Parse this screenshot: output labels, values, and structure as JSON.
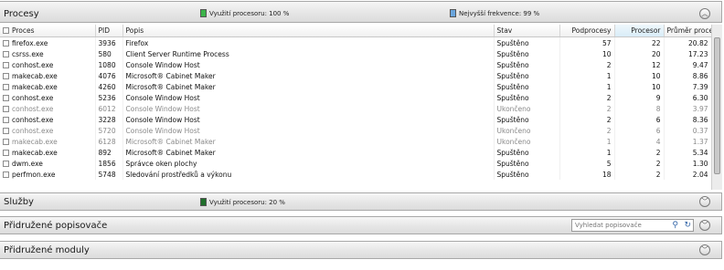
{
  "processes": {
    "title": "Procesy",
    "cpu_usage": "Využití procesoru: 100 %",
    "max_freq": "Nejvyšší frekvence: 99 %",
    "cpu_color": "#3cb44a",
    "freq_color": "#6aa5dd",
    "columns": [
      "Proces",
      "PID",
      "Popis",
      "Stav",
      "Podprocesy",
      "Procesor",
      "Průměr proces..."
    ],
    "rows": [
      {
        "name": "firefox.exe",
        "pid": "3936",
        "desc": "Firefox",
        "state": "Spuštěno",
        "threads": "57",
        "cpu": "22",
        "avg": "20.82",
        "dim": false
      },
      {
        "name": "csrss.exe",
        "pid": "580",
        "desc": "Client Server Runtime Process",
        "state": "Spuštěno",
        "threads": "10",
        "cpu": "20",
        "avg": "17.23",
        "dim": false
      },
      {
        "name": "conhost.exe",
        "pid": "1080",
        "desc": "Console Window Host",
        "state": "Spuštěno",
        "threads": "2",
        "cpu": "12",
        "avg": "9.47",
        "dim": false
      },
      {
        "name": "makecab.exe",
        "pid": "4076",
        "desc": "Microsoft® Cabinet Maker",
        "state": "Spuštěno",
        "threads": "1",
        "cpu": "10",
        "avg": "8.86",
        "dim": false
      },
      {
        "name": "makecab.exe",
        "pid": "4260",
        "desc": "Microsoft® Cabinet Maker",
        "state": "Spuštěno",
        "threads": "1",
        "cpu": "10",
        "avg": "7.39",
        "dim": false
      },
      {
        "name": "conhost.exe",
        "pid": "5236",
        "desc": "Console Window Host",
        "state": "Spuštěno",
        "threads": "2",
        "cpu": "9",
        "avg": "6.30",
        "dim": false
      },
      {
        "name": "conhost.exe",
        "pid": "6012",
        "desc": "Console Window Host",
        "state": "Ukončeno",
        "threads": "2",
        "cpu": "8",
        "avg": "3.97",
        "dim": true
      },
      {
        "name": "conhost.exe",
        "pid": "3228",
        "desc": "Console Window Host",
        "state": "Spuštěno",
        "threads": "2",
        "cpu": "6",
        "avg": "8.36",
        "dim": false
      },
      {
        "name": "conhost.exe",
        "pid": "5720",
        "desc": "Console Window Host",
        "state": "Ukončeno",
        "threads": "2",
        "cpu": "6",
        "avg": "0.37",
        "dim": true
      },
      {
        "name": "makecab.exe",
        "pid": "6128",
        "desc": "Microsoft® Cabinet Maker",
        "state": "Ukončeno",
        "threads": "1",
        "cpu": "4",
        "avg": "1.37",
        "dim": true
      },
      {
        "name": "makecab.exe",
        "pid": "892",
        "desc": "Microsoft® Cabinet Maker",
        "state": "Spuštěno",
        "threads": "1",
        "cpu": "2",
        "avg": "5.34",
        "dim": false
      },
      {
        "name": "dwm.exe",
        "pid": "1856",
        "desc": "Správce oken plochy",
        "state": "Spuštěno",
        "threads": "5",
        "cpu": "2",
        "avg": "1.30",
        "dim": false
      },
      {
        "name": "perfmon.exe",
        "pid": "5748",
        "desc": "Sledování prostředků a výkonu",
        "state": "Spuštěno",
        "threads": "18",
        "cpu": "2",
        "avg": "2.04",
        "dim": false
      }
    ]
  },
  "services": {
    "title": "Služby",
    "cpu_usage": "Využití procesoru: 20 %",
    "cpu_color": "#1f6e2a"
  },
  "handles": {
    "title": "Přidružené popisovače",
    "search_placeholder": "Vyhledat popisovače"
  },
  "modules": {
    "title": "Přidružené moduly"
  },
  "icons": {
    "collapse": "chevron-up-icon",
    "expand": "chevron-down-icon",
    "search": "search-icon",
    "refresh": "refresh-icon"
  }
}
